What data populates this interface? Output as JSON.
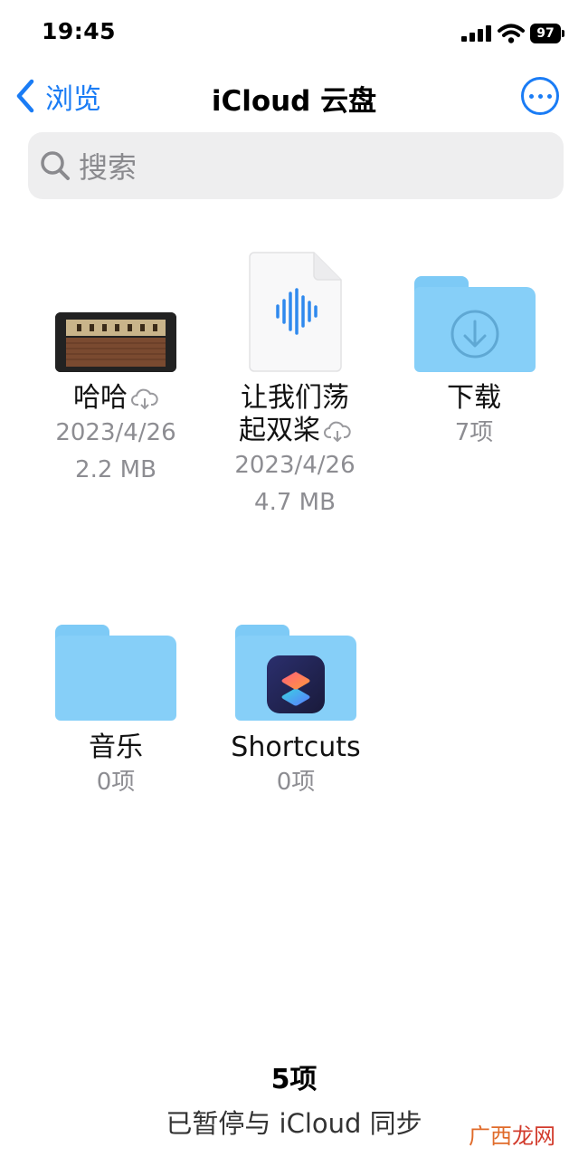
{
  "status_bar": {
    "time": "19:45",
    "battery": "97"
  },
  "nav": {
    "back_label": "浏览",
    "title": "iCloud 云盘"
  },
  "search": {
    "placeholder": "搜索"
  },
  "items": [
    {
      "name": "哈哈",
      "date": "2023/4/26",
      "size": "2.2 MB",
      "kind": "file"
    },
    {
      "name_line1": "让我们荡",
      "name_line2": "起双桨",
      "date": "2023/4/26",
      "size": "4.7 MB",
      "kind": "file"
    },
    {
      "name": "下载",
      "count": "7项",
      "kind": "folder"
    },
    {
      "name": "音乐",
      "count": "0项",
      "kind": "folder"
    },
    {
      "name": "Shortcuts",
      "count": "0项",
      "kind": "folder"
    }
  ],
  "footer": {
    "count": "5项",
    "status": "已暂停与 iCloud 同步"
  },
  "watermark": {
    "part1": "广西",
    "part2": "龙网"
  },
  "colors": {
    "accent": "#1a7cf5",
    "folder": "#86cff8",
    "secondary_text": "#8d8d92"
  },
  "icons": [
    "chevron-left-icon",
    "more-icon",
    "search-icon",
    "cloud-download-icon",
    "audio-wave-icon",
    "download-arrow-icon",
    "shortcuts-app-icon"
  ]
}
